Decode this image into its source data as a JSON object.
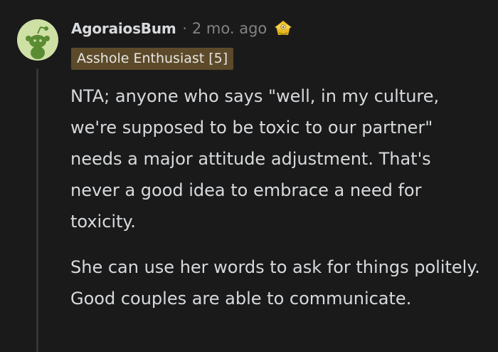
{
  "comment": {
    "author": "AgoraiosBum",
    "separator": "·",
    "timestamp": "2 mo. ago",
    "flair": "Asshole Enthusiast [5]",
    "paragraphs": [
      "NTA; anyone who says \"well, in my culture, we're supposed to be toxic to our partner\" needs a major attitude adjustment. That's never a good idea to embrace a need for toxicity.",
      "She can use her words to ask for things politely. Good couples are able to communicate."
    ]
  },
  "icons": {
    "avatar": "snoo-avatar-icon",
    "award": "award-icon"
  },
  "colors": {
    "background": "#1a1a1b",
    "text": "#d7dadc",
    "meta": "#818384",
    "flair_bg": "#5c4a2a",
    "avatar_bg": "#cfe0a5",
    "snoo": "#5a8c34"
  }
}
